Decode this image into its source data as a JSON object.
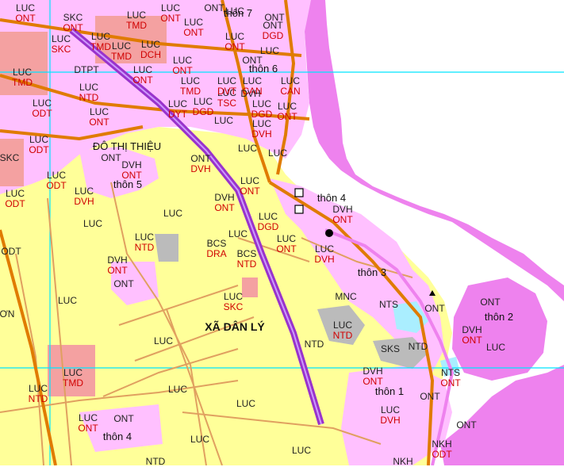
{
  "colors": {
    "water": "#ee82ee",
    "agri": "#ffff99",
    "residential": "#ffc0ff",
    "commercial": "#f4a1a1",
    "road_major": "#e07b00",
    "road_minor": "#e0a060",
    "highway": "#9933cc",
    "grid": "#00e5ff",
    "aquaculture": "#aaeeff",
    "public_land": "#bbbbbb"
  },
  "commune_label": "XÃ DÂN LÝ",
  "town_label": "ĐÔ THỊ THIỆU",
  "hamlets": {
    "thon1": "thôn 1",
    "thon2": "thôn 2",
    "thon3": "thôn 3",
    "thon4_east": "thôn 4",
    "thon4_south": "thôn 4",
    "thon5": "thôn 5",
    "thon6": "thôn 6",
    "thon7": "thôn 7"
  },
  "pairs": {
    "p1": [
      "SKC",
      "ONT"
    ],
    "p2": [
      "LUC",
      "ONT"
    ],
    "p3": [
      "LUC",
      "TMD"
    ],
    "p4": [
      "LUC",
      "SKC"
    ],
    "p5": [
      "LUC",
      "TMD"
    ],
    "p6": [
      "LUC",
      "DCH"
    ],
    "p7": [
      "LUC",
      "ONT"
    ],
    "p8": [
      "LUC",
      "TMD"
    ],
    "p9": [
      "LUC",
      "TMD"
    ],
    "p10": [
      "LUC",
      "NTD"
    ],
    "p11": [
      "LUC",
      "ODT"
    ],
    "p12": [
      "LUC",
      "ONT"
    ],
    "p13": [
      "LUC",
      "ODT"
    ],
    "p14": [
      "LUC",
      "ODT"
    ],
    "p15": [
      "LUC",
      "ODT"
    ],
    "p16": [
      "LUC",
      "DVH"
    ],
    "p17": [
      "DVH",
      "ONT"
    ],
    "p18": [
      "LUC",
      "ONT"
    ],
    "p19": [
      "DVH",
      "ONT"
    ],
    "p20": [
      "LUC",
      "DGD"
    ],
    "p21": [
      "LUC",
      "NTD"
    ],
    "p22": [
      "BCS",
      "DRA"
    ],
    "p23": [
      "BCS",
      "NTD"
    ],
    "p24": [
      "LUC",
      "ONT"
    ],
    "p25": [
      "LUC",
      "DVH"
    ],
    "p26": [
      "DVH",
      "ONT"
    ],
    "p27": [
      "DVH",
      "ONT"
    ],
    "p28": [
      "LUC",
      "SKC"
    ],
    "p29": [
      "LUC",
      "NTD"
    ],
    "p30": [
      "LUC",
      "TMD"
    ],
    "p31": [
      "LUC",
      "NTD"
    ],
    "p32": [
      "LUC",
      "ONT"
    ],
    "p33": [
      "DVH",
      "ONT"
    ],
    "p34": [
      "LUC",
      "DVH"
    ],
    "p35": [
      "NTS",
      "ONT"
    ],
    "p36": [
      "DVH",
      "ONT"
    ],
    "p37": [
      "LUC",
      "DGD"
    ],
    "p38": [
      "LUC",
      "DVH"
    ],
    "p39": [
      "LUC",
      "DGD"
    ],
    "p40": [
      "LUC",
      "TSC"
    ],
    "p41": [
      "LUC",
      "DYT"
    ],
    "p42": [
      "ONT",
      "DGD"
    ],
    "p43": [
      "LUC",
      "ONT"
    ],
    "p44": [
      "LUC",
      "ONT"
    ],
    "p45": [
      "LUC",
      "ONT"
    ],
    "p46": [
      "LUC",
      "CAN"
    ],
    "p47": [
      "LUC",
      "DVT"
    ],
    "p48": [
      "LUC",
      "TMD"
    ],
    "p49": [
      "LUC",
      "ONT"
    ],
    "p50": [
      "LUC",
      "ONT"
    ],
    "p51": [
      "NKH",
      "ODT"
    ],
    "p52": [
      "ONT",
      "DVH"
    ],
    "p53": [
      "LUC",
      "CAN"
    ]
  },
  "singles": {
    "s1": "LUC",
    "s2": "LUC",
    "s3": "LUC",
    "s4": "LUC",
    "s5": "LUC",
    "s6": "LUC",
    "s7": "LUC",
    "s8": "LUC",
    "s9": "LUC",
    "s10": "LUC",
    "s11": "ONT",
    "s12": "ONT",
    "s13": "ONT",
    "s14": "ONT",
    "s15": "ONT",
    "s16": "ONT",
    "s17": "ONT",
    "s18": "MNC",
    "s19": "NTS",
    "s20": "NTD",
    "s21": "SKS",
    "s22": "NTD",
    "s23": "DTPT",
    "s24": "ODT",
    "s25": "SKC",
    "s26": "ƠN",
    "s27": "LUC",
    "s28": "LUC",
    "s29": "NTD",
    "s30": "NKH",
    "s31": "ONT",
    "s32": "ONT",
    "s33": "LUC",
    "s34": "LUC",
    "s35": "DVH",
    "s36": "LUC",
    "s37": "ONT"
  }
}
